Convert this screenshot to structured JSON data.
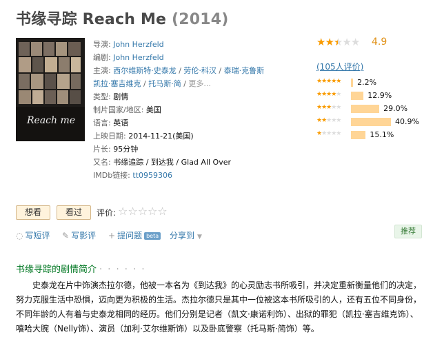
{
  "header": {
    "title_cn": "书缘寻踪",
    "title_en": "Reach Me",
    "year": "(2014)"
  },
  "poster": {
    "caption": "Reach me"
  },
  "info": {
    "director": {
      "label": "导演:",
      "value": "John Herzfeld"
    },
    "writer": {
      "label": "编剧:",
      "value": "John Herzfeld"
    },
    "cast": {
      "label": "主演:",
      "names": [
        "西尔维斯特·史泰龙",
        "劳伦·科汉",
        "泰瑞·克鲁斯",
        "凯拉·塞吉维克",
        "托马斯·简"
      ],
      "sep": " / ",
      "more": "更多..."
    },
    "genre": {
      "label": "类型:",
      "value": "剧情"
    },
    "country": {
      "label": "制片国家/地区:",
      "value": "美国"
    },
    "language": {
      "label": "语言:",
      "value": "英语"
    },
    "release": {
      "label": "上映日期:",
      "value": "2014-11-21(美国)"
    },
    "runtime": {
      "label": "片长:",
      "value": "95分钟"
    },
    "aka": {
      "label": "又名:",
      "value": "书缘追踪 / 到达我 / Glad All Over"
    },
    "imdb": {
      "label": "IMDb链接:",
      "value": "tt0959306"
    }
  },
  "rating": {
    "score": "4.9",
    "stars_fraction": 0.25,
    "count_text": "(105人评价)",
    "distribution": [
      {
        "stars": 5,
        "percent": 2.2,
        "label": "2.2%"
      },
      {
        "stars": 4,
        "percent": 12.9,
        "label": "12.9%"
      },
      {
        "stars": 3,
        "percent": 29.0,
        "label": "29.0%"
      },
      {
        "stars": 2,
        "percent": 40.9,
        "label": "40.9%"
      },
      {
        "stars": 1,
        "percent": 15.1,
        "label": "15.1%"
      }
    ]
  },
  "actions": {
    "want_label": "想看",
    "seen_label": "看过",
    "rate_label": "评价:"
  },
  "tools": {
    "short_review": "写短评",
    "review": "写影评",
    "question": "提问题",
    "beta": "beta",
    "share": "分享到"
  },
  "recommend_label": "推荐",
  "synopsis": {
    "title": "书缘寻踪的剧情简介",
    "dots": "· · · · · ·",
    "text": "史泰龙在片中饰演杰拉尔德，他被一本名为《到达我》的心灵励志书所吸引，并决定重新衡量他们的决定，努力克服生活中恐惧，迈向更为积极的生活。杰拉尔德只是其中一位被这本书所吸引的人，还有五位不同身份，不同年龄的人有着与史泰龙相同的经历。他们分别是记者（凯文·康诺利饰）、出狱的罪犯（凯拉·塞吉维克饰）、嘻哈大腕（Nelly饰）、演员（加利·艾尔维斯饰）以及卧底警察（托马斯·简饰）等。"
  },
  "colors": {
    "accent_link": "#3377aa",
    "star": "#f99b01",
    "bar": "#ffd596",
    "section_title": "#007722"
  }
}
